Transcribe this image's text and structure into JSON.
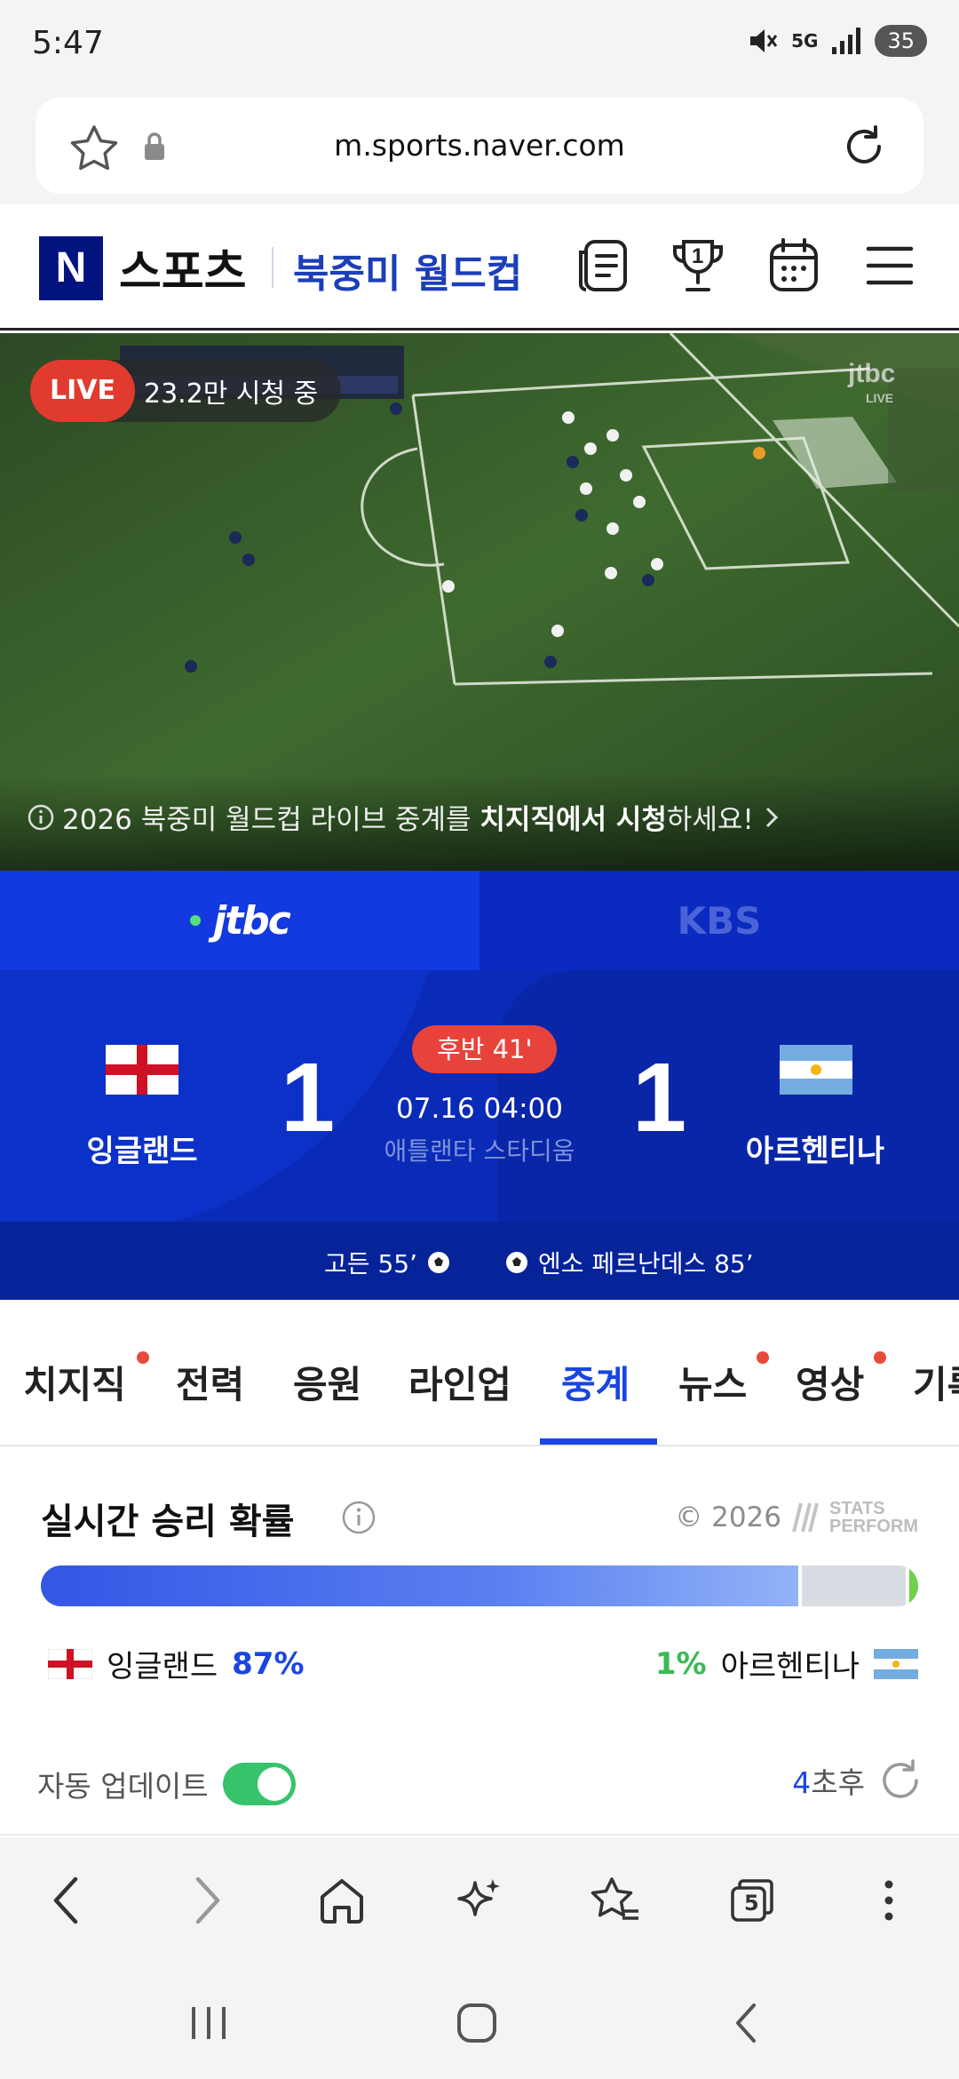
{
  "status": {
    "time": "5:47",
    "network": "5G",
    "battery": "35"
  },
  "browser": {
    "url": "m.sports.naver.com",
    "tab_count": "5"
  },
  "header": {
    "logo": "N",
    "sports": "스포츠",
    "section": "북중미 월드컵",
    "trophy_number": "1"
  },
  "video": {
    "live_label": "LIVE",
    "viewers": "23.2만 시청 중",
    "notice_prefix": "2026 북중미 월드컵 라이브 중계를 ",
    "notice_bold": "치지직에서 시청",
    "notice_suffix": "하세요!"
  },
  "broadcasters": {
    "jtbc": "jtbc",
    "kbs": "KBS"
  },
  "match": {
    "home_team": "잉글랜드",
    "home_score": "1",
    "away_team": "아르헨티나",
    "away_score": "1",
    "period": "후반 41'",
    "datetime": "07.16 04:00",
    "venue": "애틀랜타 스타디움",
    "home_scorer": "고든 55’",
    "away_scorer": "엔소 페르난데스 85’"
  },
  "section_tabs": [
    {
      "label": "치지직",
      "dot": true
    },
    {
      "label": "전력",
      "dot": false
    },
    {
      "label": "응원",
      "dot": false
    },
    {
      "label": "라인업",
      "dot": false
    },
    {
      "label": "중계",
      "dot": false,
      "active": true
    },
    {
      "label": "뉴스",
      "dot": true
    },
    {
      "label": "영상",
      "dot": true
    },
    {
      "label": "기록",
      "dot": false
    }
  ],
  "win_probability": {
    "title": "실시간 승리 확률",
    "copyright": "© 2026",
    "provider_line1": "STATS",
    "provider_line2": "PERFORM",
    "home_team": "잉글랜드",
    "home_pct": "87%",
    "home_value": 87,
    "draw_value": 12,
    "away_team": "아르헨티나",
    "away_pct": "1%",
    "away_value": 1
  },
  "auto_update": {
    "label": "자동 업데이트",
    "enabled": true,
    "countdown_num": "4",
    "countdown_suffix": "초후"
  }
}
